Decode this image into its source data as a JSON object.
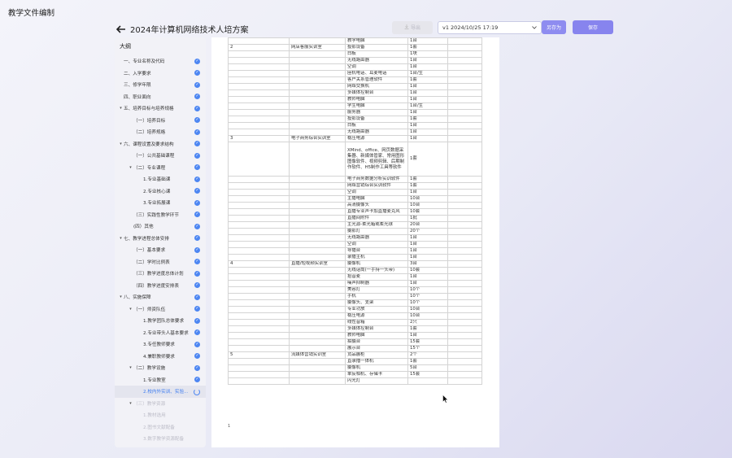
{
  "app": {
    "title": "教学文件编制"
  },
  "header": {
    "doc_title": "2024年计算机网络技术人培方案"
  },
  "toolbar": {
    "export_label": "导出",
    "version_value": "v1 2024/10/25 17:19",
    "save_as_label": "另存为",
    "save_label": "保存"
  },
  "sidebar": {
    "title": "大纲",
    "items": [
      {
        "label": "一、专业名称及代码",
        "level": 0,
        "status": "done"
      },
      {
        "label": "二、入学要求",
        "level": 0,
        "status": "done"
      },
      {
        "label": "三、修学年限",
        "level": 0,
        "status": "done"
      },
      {
        "label": "四、职业面向",
        "level": 0,
        "status": "done"
      },
      {
        "label": "五、培养目标与培养规格",
        "level": 0,
        "status": "done",
        "expanded": true
      },
      {
        "label": "（一）培养目标",
        "level": 1,
        "status": "done"
      },
      {
        "label": "（二）培养规格",
        "level": 1,
        "status": "done"
      },
      {
        "label": "六、课程设置及要求结构",
        "level": 0,
        "status": "done",
        "expanded": true
      },
      {
        "label": "（一）公共基础课程",
        "level": 1,
        "status": "done"
      },
      {
        "label": "（二）专业课程",
        "level": 1,
        "status": "done",
        "expanded": true
      },
      {
        "label": "1.专业基础课",
        "level": 2,
        "status": "done"
      },
      {
        "label": "2.专业核心课",
        "level": 2,
        "status": "done"
      },
      {
        "label": "3.专业拓展课",
        "level": 2,
        "status": "done"
      },
      {
        "label": "（三）实践性教学环节",
        "level": 1,
        "status": "done"
      },
      {
        "label": "(四）其他",
        "level": 1,
        "status": "done"
      },
      {
        "label": "七、教学进程总体安排",
        "level": 0,
        "status": "done",
        "expanded": true
      },
      {
        "label": "（一）基本要求",
        "level": 1,
        "status": "done"
      },
      {
        "label": "（二）学时比例表",
        "level": 1,
        "status": "done"
      },
      {
        "label": "（三）教学进度总体计划",
        "level": 1,
        "status": "done"
      },
      {
        "label": "（四）教学进度安排表",
        "level": 1,
        "status": "done"
      },
      {
        "label": "八、实施保障",
        "level": 0,
        "status": "done",
        "expanded": true
      },
      {
        "label": "（一）师资队伍",
        "level": 1,
        "status": "done",
        "expanded": true
      },
      {
        "label": "1.教学团队总体要求",
        "level": 2,
        "status": "done"
      },
      {
        "label": "2.专业带头人基本要求",
        "level": 2,
        "status": "done"
      },
      {
        "label": "3.专任教师要求",
        "level": 2,
        "status": "done"
      },
      {
        "label": "4.兼职教师要求",
        "level": 2,
        "status": "done"
      },
      {
        "label": "（二）教学设施",
        "level": 1,
        "status": "done",
        "expanded": true
      },
      {
        "label": "1.专业教室",
        "level": 2,
        "status": "done"
      },
      {
        "label": "2.校内外实训、实验...",
        "level": 2,
        "status": "loading"
      },
      {
        "label": "（三）教学资源",
        "level": 1,
        "status": "pending",
        "expanded": true
      },
      {
        "label": "1.教材选用",
        "level": 2,
        "status": "pending"
      },
      {
        "label": "2.图书文献配备",
        "level": 2,
        "status": "pending"
      },
      {
        "label": "3.数字教学资源配备",
        "level": 2,
        "status": "pending"
      }
    ]
  },
  "table": {
    "rows": [
      {
        "idx": "",
        "room": "",
        "eq": "教学电脑",
        "qty": "1台"
      },
      {
        "idx": "2",
        "room": "网店客服实训室",
        "eq": "投影设备",
        "qty": "1套"
      },
      {
        "idx": "",
        "room": "",
        "eq": "白板",
        "qty": "1块"
      },
      {
        "idx": "",
        "room": "",
        "eq": "无线路由器",
        "qty": "1台"
      },
      {
        "idx": "",
        "room": "",
        "eq": "空调",
        "qty": "1台"
      },
      {
        "idx": "",
        "room": "",
        "eq": "座机电话、耳麦电话",
        "qty": "1台/生"
      },
      {
        "idx": "",
        "room": "",
        "eq": "客户关系管理软件",
        "qty": "1套"
      },
      {
        "idx": "",
        "room": "",
        "eq": "网络交换机",
        "qty": "1台"
      },
      {
        "idx": "",
        "room": "",
        "eq": "多媒体控制台",
        "qty": "1台"
      },
      {
        "idx": "",
        "room": "",
        "eq": "教师电脑",
        "qty": "1台"
      },
      {
        "idx": "",
        "room": "",
        "eq": "学生电脑",
        "qty": "1台/生"
      },
      {
        "idx": "",
        "room": "",
        "eq": "服务器",
        "qty": "1台"
      },
      {
        "idx": "",
        "room": "",
        "eq": "投影设备",
        "qty": "1套"
      },
      {
        "idx": "",
        "room": "",
        "eq": "白板",
        "qty": "1台"
      },
      {
        "idx": "",
        "room": "",
        "eq": "无线路由器",
        "qty": "1台"
      },
      {
        "idx": "3",
        "room": "电子商务综合实训室",
        "eq": "稳压电源",
        "qty": "1台"
      },
      {
        "idx": "",
        "room": "",
        "eq": "XMind、office、网页数据采集器、新媒体管家、常用图形图像软件、视频剪辑、后期制作软件、H5制作工具等软件",
        "qty": "1套",
        "tall": 6
      },
      {
        "idx": "",
        "room": "",
        "eq": "电子商务数据分析实训软件",
        "qty": "1套"
      },
      {
        "idx": "",
        "room": "",
        "eq": "网络营销综合实训软件",
        "qty": "1套"
      },
      {
        "idx": "",
        "room": "",
        "eq": "空调",
        "qty": "1台"
      },
      {
        "idx": "",
        "room": "",
        "eq": "主播电脑",
        "qty": "10台"
      },
      {
        "idx": "",
        "room": "",
        "eq": "高清摄像头",
        "qty": "10台"
      },
      {
        "idx": "",
        "room": "",
        "eq": "直播专业声卡加直播麦克风",
        "qty": "10套"
      },
      {
        "idx": "",
        "room": "",
        "eq": "直播间附件",
        "qty": "1批"
      },
      {
        "idx": "",
        "room": "",
        "eq": "主光源-柔光箱或柔光球",
        "qty": "20台"
      },
      {
        "idx": "",
        "room": "",
        "eq": "摄影灯",
        "qty": "20个"
      },
      {
        "idx": "",
        "room": "",
        "eq": "无线路由器",
        "qty": "1台"
      },
      {
        "idx": "",
        "room": "",
        "eq": "空调",
        "qty": "1台"
      },
      {
        "idx": "",
        "room": "",
        "eq": "导播台",
        "qty": "1台"
      },
      {
        "idx": "",
        "room": "",
        "eq": "录播主机",
        "qty": "1台"
      },
      {
        "idx": "4",
        "room": "直播/短视频实训室",
        "eq": "摄像机",
        "qty": "3台"
      },
      {
        "idx": "",
        "room": "",
        "eq": "无线话筒(一手持一头带)",
        "qty": "10套"
      },
      {
        "idx": "",
        "room": "",
        "eq": "拾音麦",
        "qty": "1台"
      },
      {
        "idx": "",
        "room": "",
        "eq": "噪声抑制器",
        "qty": "1台"
      },
      {
        "idx": "",
        "room": "",
        "eq": "美容灯",
        "qty": "10个"
      },
      {
        "idx": "",
        "room": "",
        "eq": "手机",
        "qty": "10个"
      },
      {
        "idx": "",
        "room": "",
        "eq": "摄像头、支架",
        "qty": "10个"
      },
      {
        "idx": "",
        "room": "",
        "eq": "专业功放",
        "qty": "10台"
      },
      {
        "idx": "",
        "room": "",
        "eq": "稳压电源",
        "qty": "10台"
      },
      {
        "idx": "",
        "room": "",
        "eq": "线性音箱",
        "qty": "2只"
      },
      {
        "idx": "",
        "room": "",
        "eq": "多媒体控制台",
        "qty": "1套"
      },
      {
        "idx": "",
        "room": "",
        "eq": "教师电脑",
        "qty": "1台"
      },
      {
        "idx": "",
        "room": "",
        "eq": "拍摄台",
        "qty": "15套"
      },
      {
        "idx": "",
        "room": "",
        "eq": "展示台",
        "qty": "15个"
      },
      {
        "idx": "5",
        "room": "流媒体营销实训室",
        "eq": "货品展柜",
        "qty": "2个"
      },
      {
        "idx": "",
        "room": "",
        "eq": "直录播一体机",
        "qty": "1套"
      },
      {
        "idx": "",
        "room": "",
        "eq": "摄像机",
        "qty": "5台"
      },
      {
        "idx": "",
        "room": "",
        "eq": "单反相机、存储卡",
        "qty": "15套"
      },
      {
        "idx": "",
        "room": "",
        "eq": "闪光灯",
        "qty": ""
      }
    ],
    "page_number": "1"
  },
  "colors": {
    "accent": "#8784ee",
    "check": "#4d86f2",
    "link": "#3c7bf0"
  }
}
